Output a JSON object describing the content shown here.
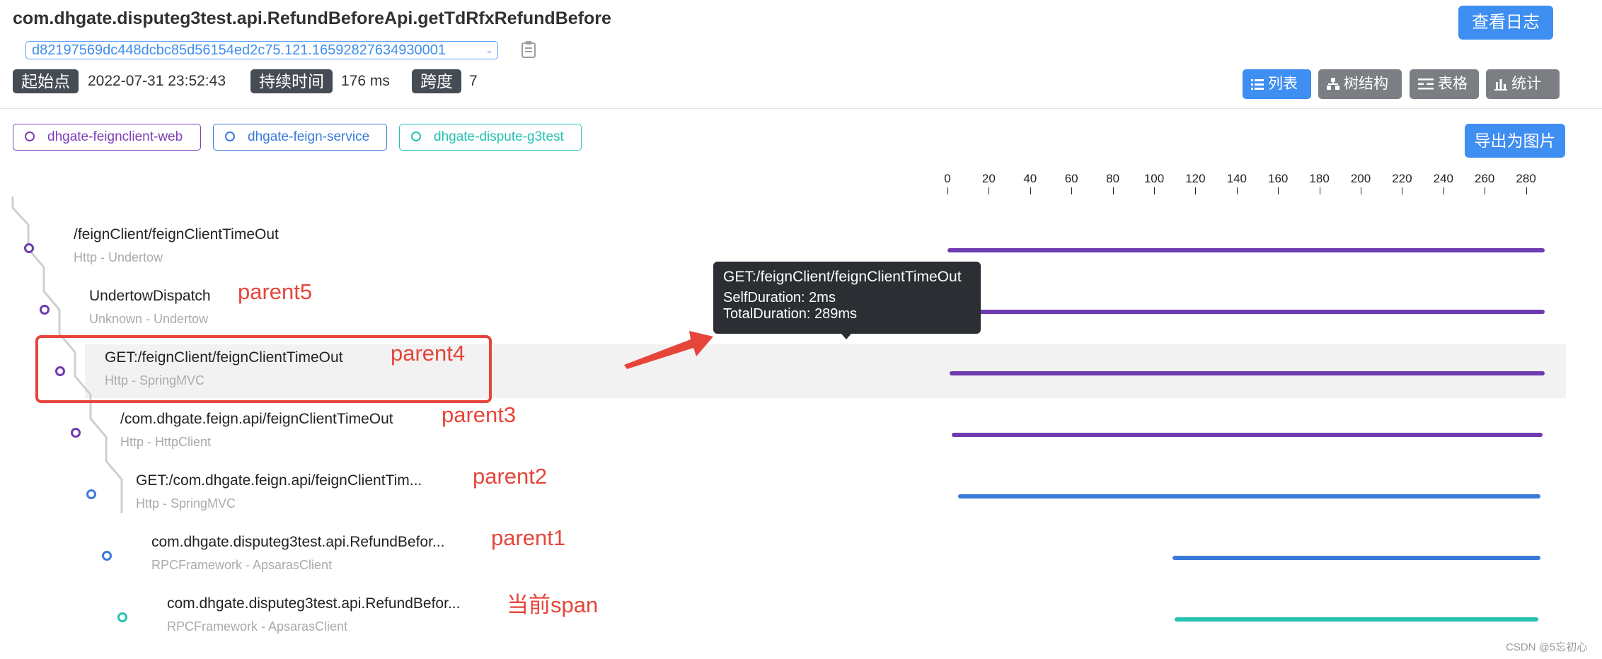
{
  "header": {
    "title": "com.dhgate.disputeg3test.api.RefundBeforeApi.getTdRfxRefundBefore",
    "trace_id": "d82197569dc448dcbc85d56154ed2c75.121.16592827634930001",
    "view_log_label": "查看日志",
    "start_label": "起始点",
    "start_value": "2022-07-31 23:52:43",
    "duration_label": "持续时间",
    "duration_value": "176 ms",
    "depth_label": "跨度",
    "depth_value": "7"
  },
  "views": [
    {
      "label": "列表",
      "icon": "list-icon",
      "active": true
    },
    {
      "label": "树结构",
      "icon": "tree-icon",
      "active": false
    },
    {
      "label": "表格",
      "icon": "table-icon",
      "active": false
    },
    {
      "label": "统计",
      "icon": "stats-icon",
      "active": false
    }
  ],
  "services": [
    {
      "name": "dhgate-feignclient-web",
      "color": "#7d3fb6"
    },
    {
      "name": "dhgate-feign-service",
      "color": "#3a7ad9"
    },
    {
      "name": "dhgate-dispute-g3test",
      "color": "#25c2b3"
    }
  ],
  "export_label": "导出为图片",
  "axis": {
    "ticks": [
      "0",
      "20",
      "40",
      "60",
      "80",
      "100",
      "120",
      "140",
      "160",
      "180",
      "200",
      "220",
      "240",
      "260",
      "280"
    ],
    "min": 0,
    "max": 290
  },
  "spans": [
    {
      "title": "/feignClient/feignClientTimeOut",
      "subtitle": "Http - Undertow",
      "color": "#6f3bb0",
      "start": 0,
      "end": 289,
      "annotation": ""
    },
    {
      "title": "UndertowDispatch",
      "subtitle": "Unknown - Undertow",
      "color": "#6f3bb0",
      "start": 0,
      "end": 289,
      "annotation": "parent5"
    },
    {
      "title": "GET:/feignClient/feignClientTimeOut",
      "subtitle": "Http - SpringMVC",
      "color": "#6f3bb0",
      "start": 1,
      "end": 289,
      "annotation": "parent4"
    },
    {
      "title": "/com.dhgate.feign.api/feignClientTimeOut",
      "subtitle": "Http - HttpClient",
      "color": "#6f3bb0",
      "start": 2,
      "end": 288,
      "annotation": "parent3"
    },
    {
      "title": "GET:/com.dhgate.feign.api/feignClientTim...",
      "subtitle": "Http - SpringMVC",
      "color": "#3a7ad9",
      "start": 5,
      "end": 287,
      "annotation": "parent2"
    },
    {
      "title": "com.dhgate.disputeg3test.api.RefundBefor...",
      "subtitle": "RPCFramework - ApsarasClient",
      "color": "#3a7ad9",
      "start": 109,
      "end": 287,
      "annotation": "parent1"
    },
    {
      "title": "com.dhgate.disputeg3test.api.RefundBefor...",
      "subtitle": "RPCFramework - ApsarasClient",
      "color": "#25c2b3",
      "start": 110,
      "end": 286,
      "annotation": "当前span"
    }
  ],
  "tooltip": {
    "title": "GET:/feignClient/feignClientTimeOut",
    "self_duration": "SelfDuration: 2ms",
    "total_duration": "TotalDuration: 289ms"
  },
  "watermark": "CSDN @5忘初心"
}
